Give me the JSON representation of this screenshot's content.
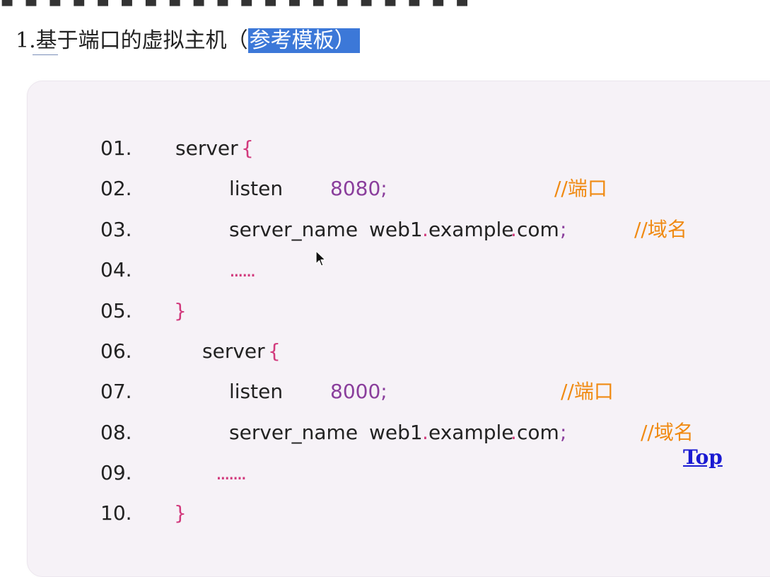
{
  "page": {
    "heading_prefix": "1.",
    "heading_text": "基于端口的虚拟主机（",
    "heading_highlight": "参考模板）"
  },
  "code": {
    "lines": [
      {
        "num": "01.",
        "parts": [
          "server",
          "{"
        ]
      },
      {
        "num": "02.",
        "parts": [
          "listen",
          "8080;",
          "//端口"
        ]
      },
      {
        "num": "03.",
        "parts": [
          "server_name",
          "web1",
          ".",
          "example",
          ".",
          "com",
          ";",
          "//域名"
        ]
      },
      {
        "num": "04.",
        "parts": [
          "......"
        ]
      },
      {
        "num": "05.",
        "parts": [
          "}"
        ]
      },
      {
        "num": "06.",
        "parts": [
          "server",
          "{"
        ]
      },
      {
        "num": "07.",
        "parts": [
          "listen",
          "8000;",
          "//端口"
        ]
      },
      {
        "num": "08.",
        "parts": [
          "server_name",
          "web1",
          ".",
          "example",
          ".",
          "com",
          ";",
          "//域名"
        ]
      },
      {
        "num": "09.",
        "parts": [
          "......."
        ]
      },
      {
        "num": "10.",
        "parts": [
          "}"
        ]
      }
    ]
  },
  "links": {
    "top_label": "Top"
  },
  "colors": {
    "keyword": "#222222",
    "brace": "#d23a7d",
    "number": "#8a3e9c",
    "comment": "#f08a12",
    "highlight": "#3c78d8",
    "link": "#1a1ad2"
  },
  "icons": {
    "cursor": "mouse-pointer-icon"
  }
}
